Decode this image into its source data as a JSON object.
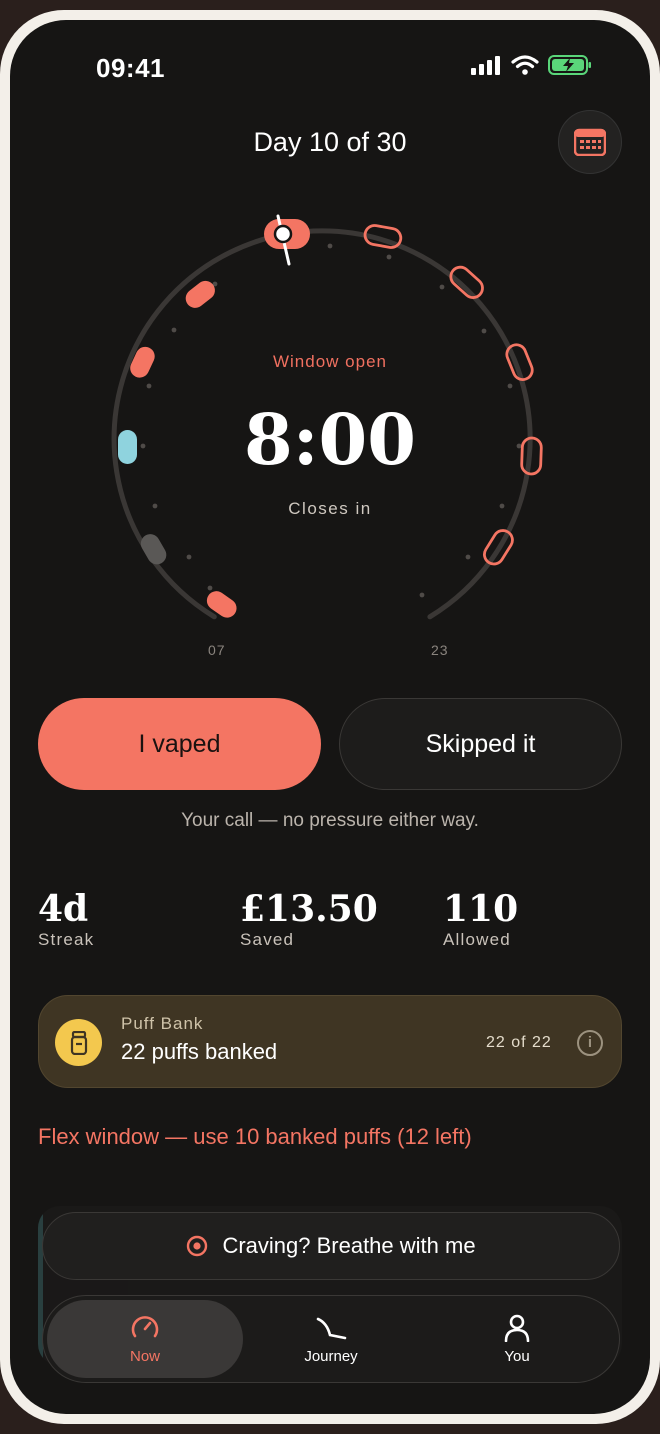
{
  "status_bar": {
    "time": "09:41"
  },
  "header": {
    "title": "Day 10 of 30",
    "calendar_icon": "calendar-icon"
  },
  "dial": {
    "state_label": "Window open",
    "countdown": "8:00",
    "countdown_caption": "Closes in",
    "start_hour_label": "07",
    "end_hour_label": "23"
  },
  "actions": {
    "vaped_label": "I vaped",
    "skipped_label": "Skipped it",
    "hint": "Your call — no pressure either way."
  },
  "stats": [
    {
      "value": "4d",
      "label": "Streak"
    },
    {
      "value": "£13.50",
      "label": "Saved"
    },
    {
      "value": "110",
      "label": "Allowed"
    }
  ],
  "puff_bank": {
    "title": "Puff Bank",
    "summary": "22 puffs banked",
    "count": "22 of 22",
    "info_glyph": "i"
  },
  "flex_notice": "Flex window — use 10 banked puffs (12 left)",
  "craving_button": {
    "label": "Craving? Breathe with me",
    "icon": "target-icon"
  },
  "bottom_nav": [
    {
      "label": "Now",
      "icon": "gauge-icon",
      "active": true
    },
    {
      "label": "Journey",
      "icon": "path-icon",
      "active": false
    },
    {
      "label": "You",
      "icon": "person-icon",
      "active": false
    }
  ],
  "colors": {
    "accent": "#f47563",
    "background": "#161514",
    "bank_bg": "#3f3523",
    "bank_icon": "#f3c84e",
    "slot_teal": "#8fd3de",
    "slot_grey": "#5a5856"
  }
}
